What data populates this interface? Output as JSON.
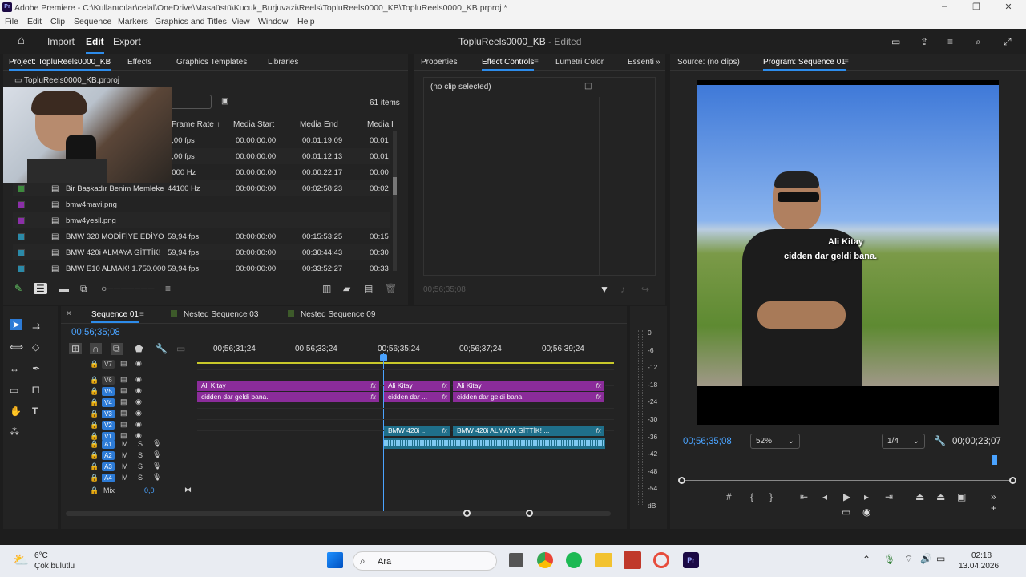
{
  "window": {
    "title": "Adobe Premiere - C:\\Kullanıcılar\\celal\\OneDrive\\Masaüstü\\Kucuk_Burjuvazi\\Reels\\TopluReels0000_KB\\TopluReels0000_KB.prproj *",
    "logo": "Pr"
  },
  "menu": [
    "File",
    "Edit",
    "Clip",
    "Sequence",
    "Markers",
    "Graphics and Titles",
    "View",
    "Window",
    "Help"
  ],
  "topbar": {
    "import": "Import",
    "edit": "Edit",
    "export": "Export",
    "project_name": "TopluReels0000_KB",
    "status": " - Edited"
  },
  "project": {
    "tabs": [
      "Project: TopluReels0000_KB",
      "Effects",
      "Graphics Templates",
      "Libraries"
    ],
    "file": "TopluReels0000_KB.prproj",
    "items": "61 items",
    "headers": [
      "Frame Rate",
      "Media Start",
      "Media End",
      "Media I"
    ],
    "rows": [
      {
        "name": "",
        "rate": "0,00 fps",
        "start": "00:00:00:00",
        "end": "00:01:19:09",
        "mi": "00:01",
        "color": "#3d8a3d"
      },
      {
        "name": "",
        "rate": "0,00 fps",
        "start": "00:00:00:00",
        "end": "00:01:12:13",
        "mi": "00:01",
        "color": "#3d8a3d"
      },
      {
        "name": "",
        "rate": "3000 Hz",
        "start": "00:00:00:00",
        "end": "00:00:22:17",
        "mi": "00:00",
        "color": "#3d8a3d"
      },
      {
        "name": "Bir Başkadır Benim Memleke",
        "rate": "44100 Hz",
        "start": "00:00:00:00",
        "end": "00:02:58:23",
        "mi": "00:02",
        "color": "#3d8a3d"
      },
      {
        "name": "bmw4mavi.png",
        "rate": "",
        "start": "",
        "end": "",
        "mi": "",
        "color": "#8b2fa8"
      },
      {
        "name": "bmw4yesil.png",
        "rate": "",
        "start": "",
        "end": "",
        "mi": "",
        "color": "#8b2fa8"
      },
      {
        "name": "BMW 320 MODİFİYE EDİYO",
        "rate": "59,94 fps",
        "start": "00:00:00:00",
        "end": "00:15:53:25",
        "mi": "00:15",
        "color": "#2b8aa8"
      },
      {
        "name": "BMW 420i ALMAYA GİTTİK!",
        "rate": "59,94 fps",
        "start": "00:00:00:00",
        "end": "00:30:44:43",
        "mi": "00:30",
        "color": "#2b8aa8"
      },
      {
        "name": "BMW E10 ALMAK! 1.750.000",
        "rate": "59,94 fps",
        "start": "00:00:00:00",
        "end": "00:33:52:27",
        "mi": "00:33",
        "color": "#2b8aa8"
      }
    ]
  },
  "effects": {
    "tabs": [
      "Properties",
      "Effect Controls",
      "Lumetri Color",
      "Essenti"
    ],
    "clip": "(no clip selected)",
    "time": "00;56;35;08"
  },
  "monitor": {
    "source": "Source: (no clips)",
    "program": "Program: Sequence 01",
    "caption1": "Ali Kitay",
    "caption2": "cidden dar geldi bana.",
    "timecode": "00;56;35;08",
    "zoom": "52%",
    "quality": "1/4",
    "duration": "00;00;23;07"
  },
  "timeline": {
    "tabs": [
      "Sequence 01",
      "Nested Sequence 03",
      "Nested Sequence 09"
    ],
    "timecode": "00;56;35;08",
    "ruler": [
      "00;56;31;24",
      "00;56;33;24",
      "00;56;35;24",
      "00;56;37;24",
      "00;56;39;24"
    ],
    "vtracks": [
      "V7",
      "V6",
      "V5",
      "V4",
      "V3",
      "V2",
      "V1"
    ],
    "atracks": [
      "A1",
      "A2",
      "A3",
      "A4"
    ],
    "mix": "Mix",
    "mixval": "0,0",
    "clips": {
      "v5a": "Ali Kitay",
      "v5b": "Ali Kitay",
      "v5c": "Ali Kitay",
      "v4a": "cidden dar geldi bana.",
      "v4b": "cidden dar ...",
      "v4c": "cidden dar geldi bana.",
      "v1a": "BMW 420i ...",
      "v1b": "BMW 420i ALMAYA GİTTİK! ...",
      "fx": "fx"
    }
  },
  "meter": [
    "0",
    "-6",
    "-12",
    "-18",
    "-24",
    "-30",
    "-36",
    "-42",
    "-48",
    "-54",
    "dB"
  ],
  "taskbar": {
    "temp": "6°C",
    "weather": "Çok bulutlu",
    "search": "Ara",
    "time": "02:18",
    "date": "13.04.2026"
  }
}
